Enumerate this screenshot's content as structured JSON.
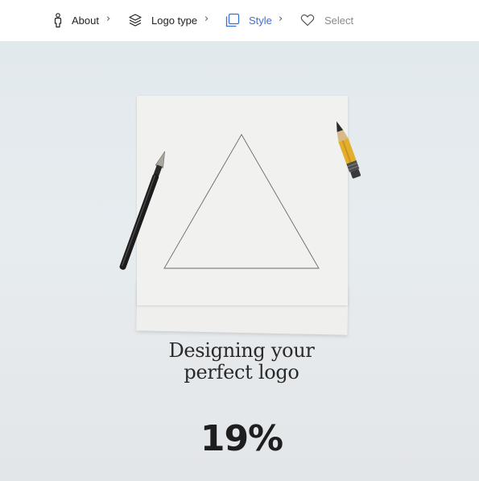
{
  "steps": [
    {
      "label": "About",
      "icon": "person-icon",
      "state": "done",
      "color": "#222222"
    },
    {
      "label": "Logo type",
      "icon": "layers-icon",
      "state": "done",
      "color": "#222222"
    },
    {
      "label": "Style",
      "icon": "copy-icon",
      "state": "active",
      "color": "#3a6fd8"
    },
    {
      "label": "Select",
      "icon": "heart-icon",
      "state": "upcoming",
      "color": "#8a8a8a"
    }
  ],
  "chevron": "›",
  "loading": {
    "title_line1": "Designing your",
    "title_line2": "perfect logo",
    "progress_percent": "19%"
  },
  "colors": {
    "active": "#3a6fd8",
    "text": "#222222",
    "muted": "#8a8a8a"
  }
}
